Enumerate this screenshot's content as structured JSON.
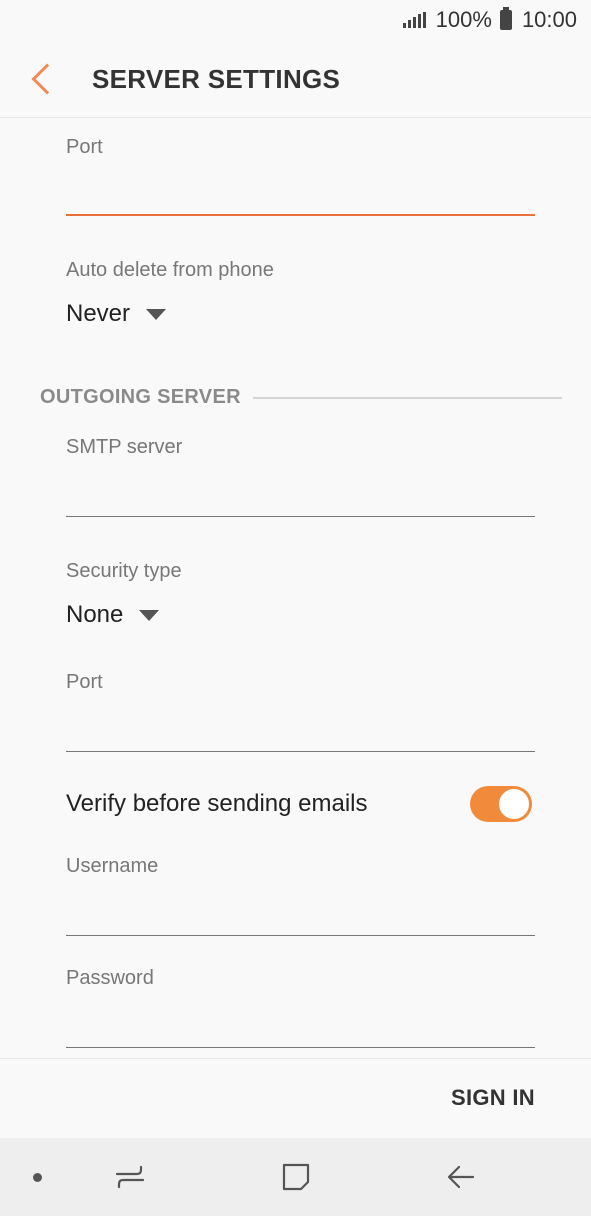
{
  "status": {
    "battery": "100%",
    "time": "10:00"
  },
  "header": {
    "title": "SERVER SETTINGS"
  },
  "incoming": {
    "port_label": "Port",
    "port_value": "",
    "auto_delete_label": "Auto delete from phone",
    "auto_delete_value": "Never"
  },
  "outgoing": {
    "section_title": "OUTGOING SERVER",
    "smtp_label": "SMTP server",
    "smtp_value": "",
    "security_label": "Security type",
    "security_value": "None",
    "port_label": "Port",
    "port_value": "",
    "verify_label": "Verify before sending emails",
    "verify_enabled": true,
    "username_label": "Username",
    "username_value": "",
    "password_label": "Password",
    "password_value": ""
  },
  "actions": {
    "sign_in": "SIGN IN"
  },
  "colors": {
    "accent": "#f08a57",
    "toggle_on": "#f28a3c"
  },
  "icons": [
    "signal-icon",
    "battery-icon",
    "back-icon",
    "dropdown-arrow-icon",
    "recents-icon",
    "home-icon",
    "nav-back-icon"
  ]
}
